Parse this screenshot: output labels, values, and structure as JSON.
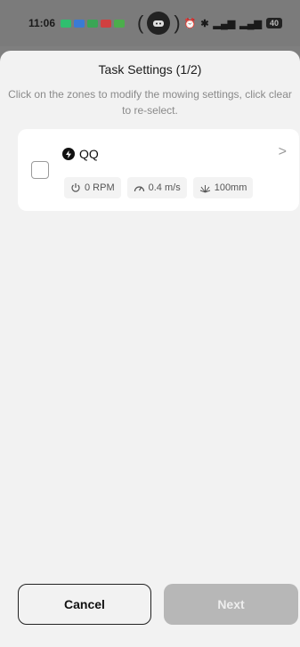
{
  "status_bar": {
    "time": "11:06",
    "right_icons": [
      "alarm-icon",
      "bluetooth-icon",
      "signal-icon",
      "signal-icon"
    ],
    "battery": "40"
  },
  "sheet": {
    "title": "Task Settings (1/2)",
    "subtitle": "Click on the zones to modify the mowing settings, click clear to re-select."
  },
  "zone": {
    "name": "QQ",
    "checked": false,
    "rpm": "0 RPM",
    "speed": "0.4 m/s",
    "height": "100mm"
  },
  "footer": {
    "cancel_label": "Cancel",
    "next_label": "Next"
  },
  "colors": {
    "next_disabled": "#b7b7b7",
    "sheet_bg": "#f2f2f2",
    "card_bg": "#ffffff"
  }
}
